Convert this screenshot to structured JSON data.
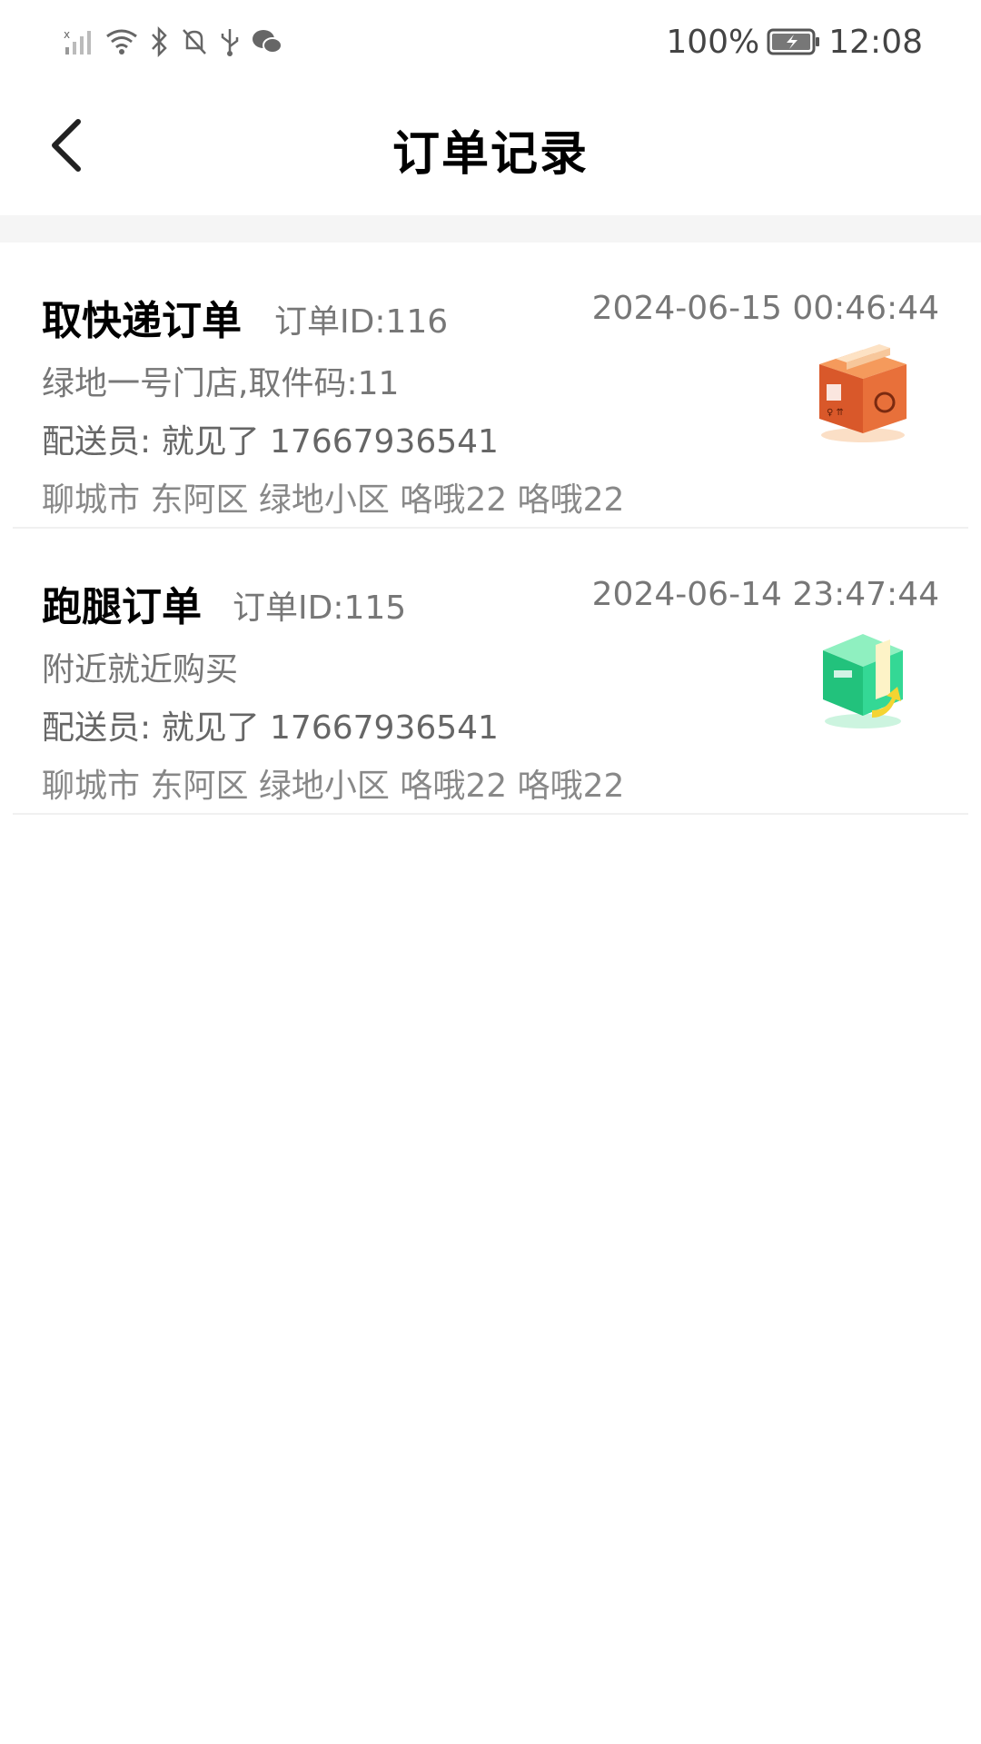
{
  "status_bar": {
    "battery_percent": "100%",
    "time": "12:08",
    "icons": [
      "signal-icon",
      "wifi-icon",
      "bluetooth-icon",
      "mute-icon",
      "usb-icon",
      "wechat-icon",
      "battery-icon"
    ]
  },
  "header": {
    "title": "订单记录",
    "back_icon": "back-arrow-icon"
  },
  "orders": [
    {
      "type": "取快递订单",
      "id_label": "订单ID:116",
      "time": "2024-06-15 00:46:44",
      "detail": "绿地一号门店,取件码:11",
      "courier": "配送员:  就见了 17667936541",
      "address": "聊城市 东阿区 绿地小区 咯哦22 咯哦22",
      "icon": "parcel-box-icon",
      "accent": "#e8703a"
    },
    {
      "type": "跑腿订单",
      "id_label": "订单ID:115",
      "time": "2024-06-14 23:47:44",
      "detail": "附近就近购买",
      "courier": "配送员:  就见了 17667936541",
      "address": "聊城市 东阿区 绿地小区 咯哦22 咯哦22",
      "icon": "errand-box-icon",
      "accent": "#2fd18a"
    }
  ]
}
